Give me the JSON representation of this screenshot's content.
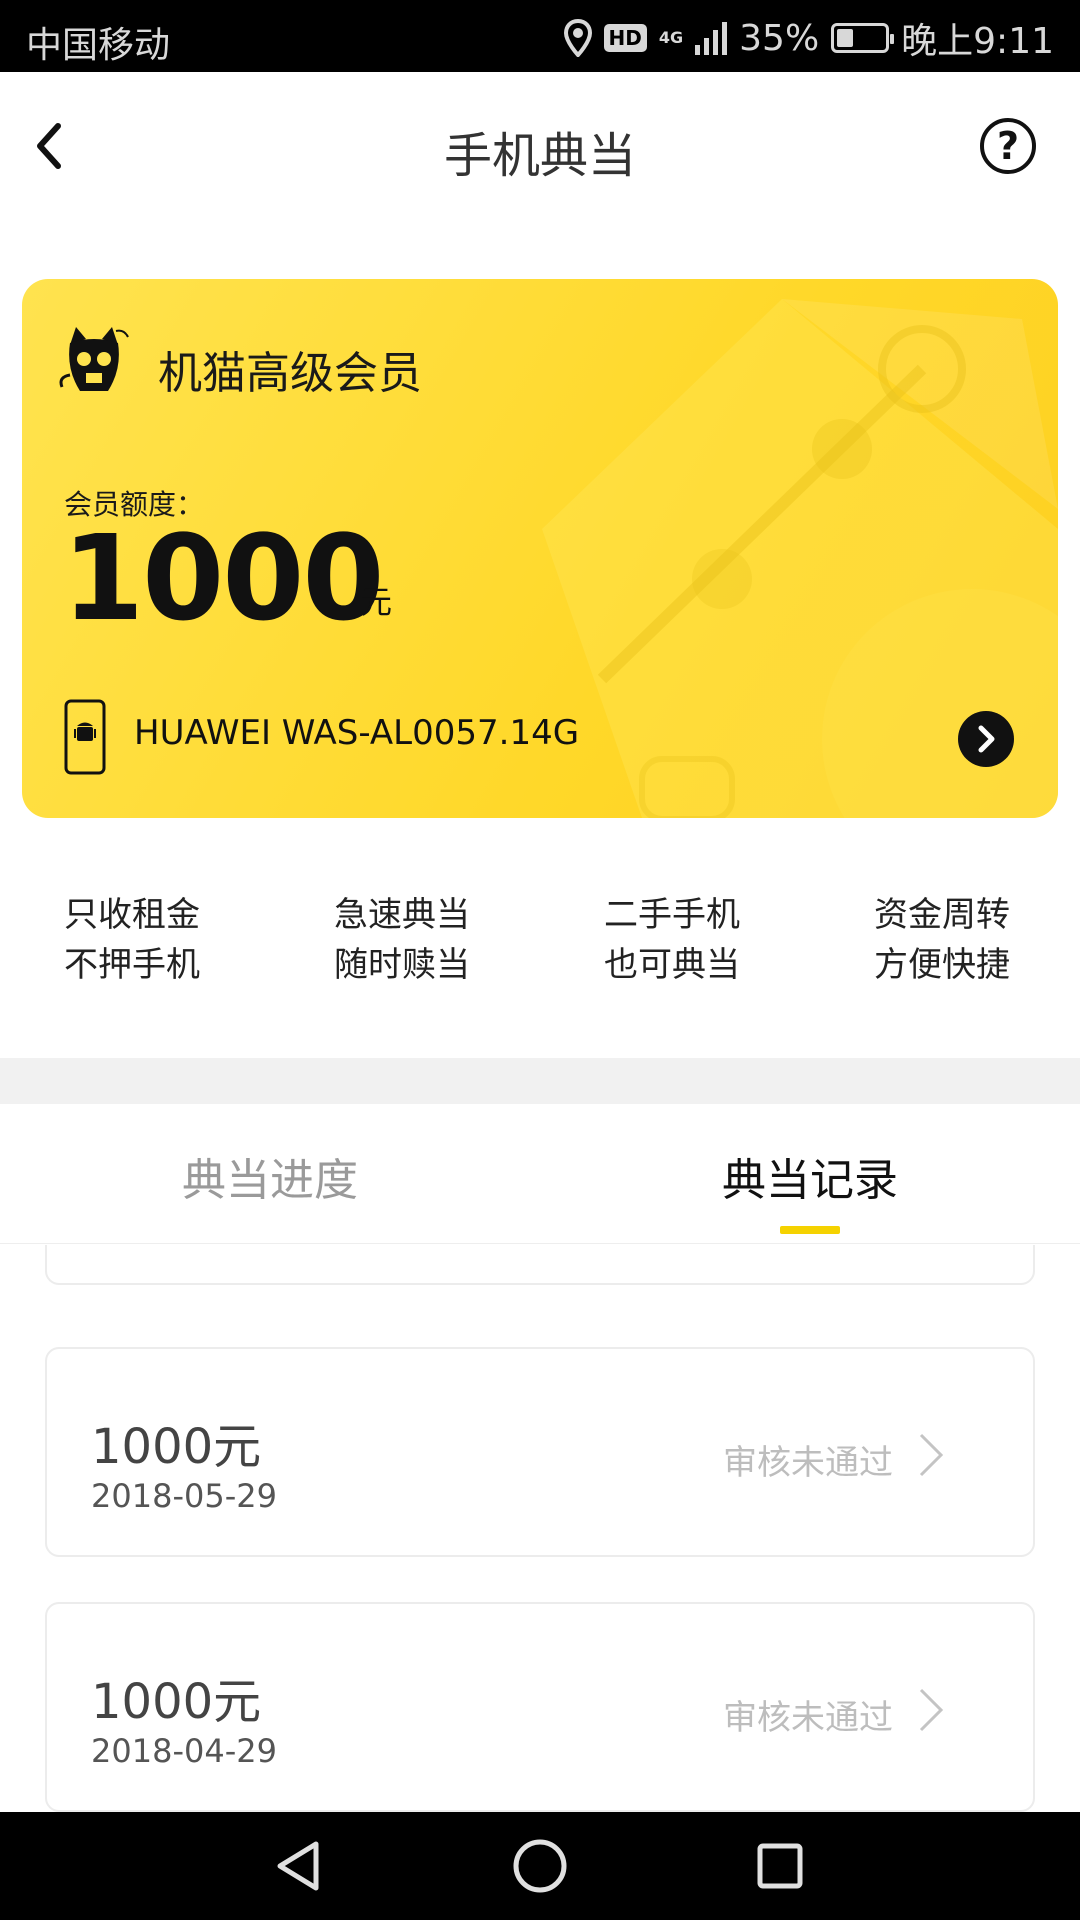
{
  "status_bar": {
    "carrier": "中国移动",
    "hd": "HD",
    "network": "4G",
    "battery_percent": "35%",
    "battery_level": 0.35,
    "time": "晚上9:11"
  },
  "header": {
    "title": "手机典当",
    "help_symbol": "?"
  },
  "member_card": {
    "title": "机猫高级会员",
    "quota_label": "会员额度：",
    "quota_value": "1000",
    "quota_unit": "元",
    "device": "HUAWEI WAS-AL0057.14G",
    "colors": {
      "card_yellow": "#ffd829",
      "accent": "#f5d200"
    }
  },
  "features": [
    {
      "line1": "只收租金",
      "line2": "不押手机"
    },
    {
      "line1": "急速典当",
      "line2": "随时赎当"
    },
    {
      "line1": "二手手机",
      "line2": "也可典当"
    },
    {
      "line1": "资金周转",
      "line2": "方便快捷"
    }
  ],
  "tabs": [
    {
      "label": "典当进度",
      "active": false
    },
    {
      "label": "典当记录",
      "active": true
    }
  ],
  "records": [
    {
      "amount": "1000元",
      "date": "2018-05-29",
      "status": "审核未通过"
    },
    {
      "amount": "1000元",
      "date": "2018-04-29",
      "status": "审核未通过"
    }
  ],
  "icons": {
    "back": "back-arrow-icon",
    "help": "help-circle-icon",
    "logo": "cat-logo-icon",
    "phone": "android-phone-icon",
    "go": "chevron-right-circle-icon",
    "record_arrow": "chevron-right-icon",
    "nav_back": "triangle-back-icon",
    "nav_home": "circle-home-icon",
    "nav_recent": "square-recents-icon"
  }
}
